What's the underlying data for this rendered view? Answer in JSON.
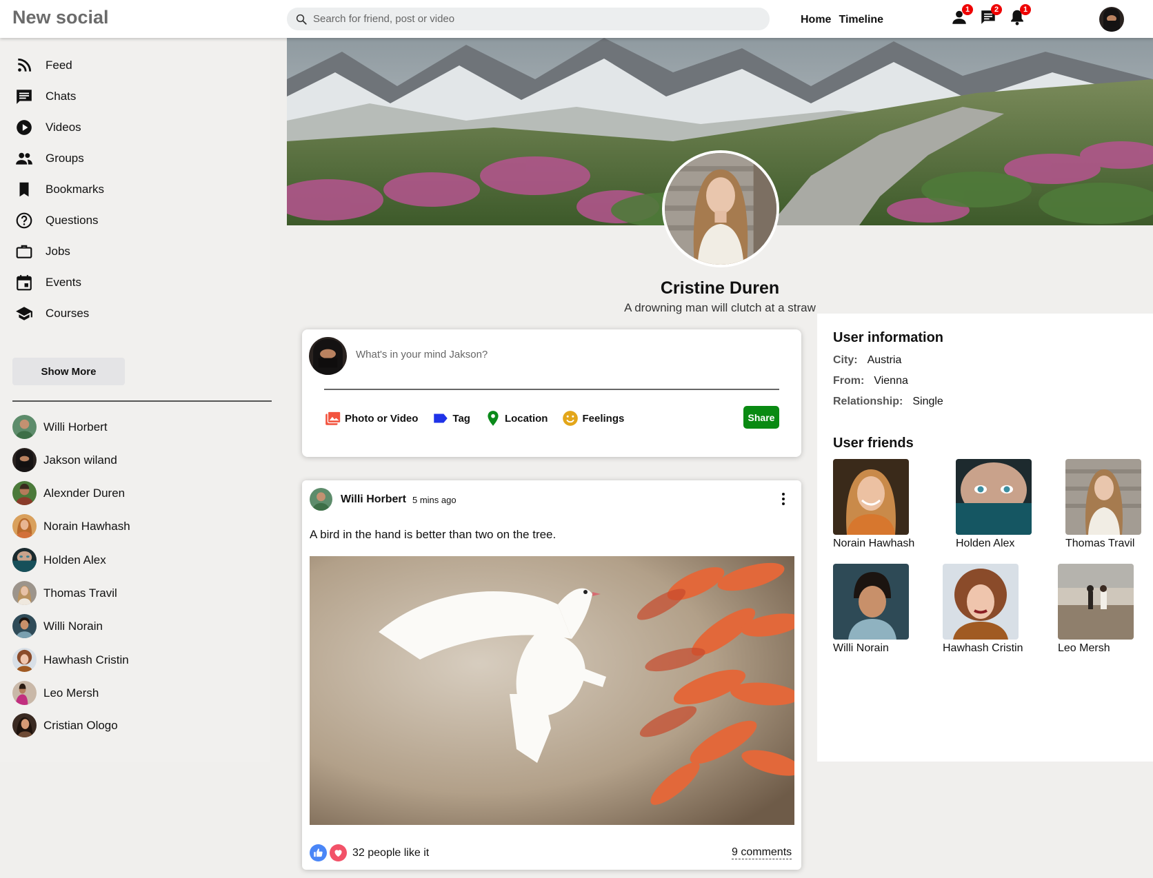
{
  "topbar": {
    "logo": "New social",
    "search_placeholder": "Search for friend, post or video",
    "nav": [
      "Home",
      "Timeline"
    ],
    "badges": {
      "friends": "1",
      "messages": "2",
      "notifications": "1"
    }
  },
  "sidebar": {
    "items": [
      {
        "label": "Feed",
        "icon": "rss-feed-icon"
      },
      {
        "label": "Chats",
        "icon": "chat-icon"
      },
      {
        "label": "Videos",
        "icon": "play-circle-icon"
      },
      {
        "label": "Groups",
        "icon": "group-icon"
      },
      {
        "label": "Bookmarks",
        "icon": "bookmark-icon"
      },
      {
        "label": "Questions",
        "icon": "help-circle-icon"
      },
      {
        "label": "Jobs",
        "icon": "work-icon"
      },
      {
        "label": "Events",
        "icon": "event-icon"
      },
      {
        "label": "Courses",
        "icon": "school-icon"
      }
    ],
    "show_more": "Show More",
    "friends": [
      "Willi Horbert",
      "Jakson wiland",
      "Alexnder Duren",
      "Norain Hawhash",
      "Holden Alex",
      "Thomas Travil",
      "Willi Norain",
      "Hawhash Cristin",
      "Leo Mersh",
      "Cristian Ologo"
    ]
  },
  "profile": {
    "name": "Cristine Duren",
    "description": "A drowning man will clutch at a straw"
  },
  "share": {
    "placeholder": "What's in your mind Jakson?",
    "options": [
      "Photo or Video",
      "Tag",
      "Location",
      "Feelings"
    ],
    "button": "Share"
  },
  "post": {
    "user": "Willi Horbert",
    "time": "5 mins ago",
    "text": "A bird in the hand is better than two on the tree.",
    "likes": "32 people like it",
    "comments": "9 comments"
  },
  "user_info": {
    "title": "User information",
    "rows": [
      {
        "key": "City:",
        "value": "Austria"
      },
      {
        "key": "From:",
        "value": "Vienna"
      },
      {
        "key": "Relationship:",
        "value": "Single"
      }
    ]
  },
  "user_friends": {
    "title": "User friends",
    "friends": [
      "Norain Hawhash",
      "Holden Alex",
      "Thomas Travil",
      "Willi Norain",
      "Hawhash Cristin",
      "Leo Mersh"
    ]
  },
  "colors": {
    "accent_green": "#098a12",
    "badge_red": "#ee0000",
    "like_blue": "#4a86f7",
    "heart_red": "#f25268",
    "tag_blue": "#1f33e8",
    "photo_red": "#f2543f",
    "location_green": "#0a8a1a",
    "feelings_gold": "#e3a61a"
  }
}
